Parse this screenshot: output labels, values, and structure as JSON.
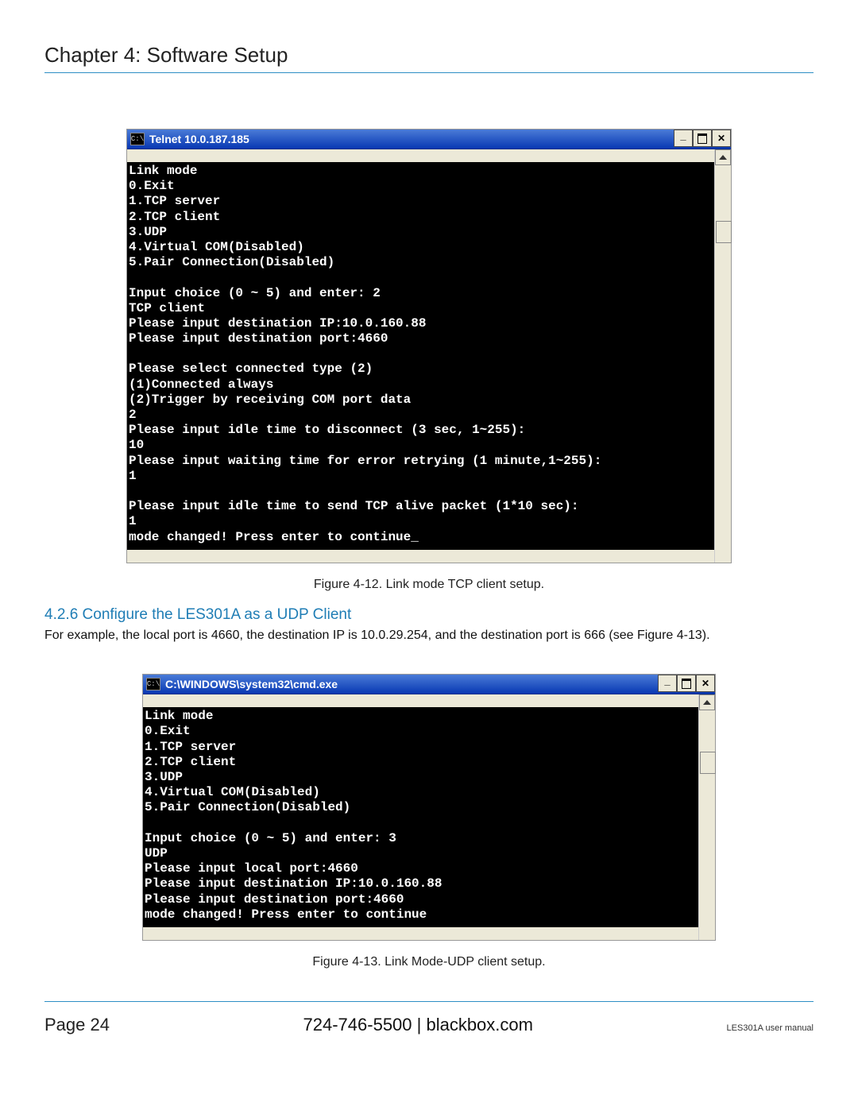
{
  "header": {
    "chapter_title": "Chapter 4: Software Setup"
  },
  "figure_12": {
    "window_title": "Telnet 10.0.187.185",
    "icon_label": "C:\\",
    "console_lines": [
      "Link mode",
      "0.Exit",
      "1.TCP server",
      "2.TCP client",
      "3.UDP",
      "4.Virtual COM(Disabled)",
      "5.Pair Connection(Disabled)",
      "",
      "Input choice (0 ~ 5) and enter: 2",
      "TCP client",
      "Please input destination IP:10.0.160.88",
      "Please input destination port:4660",
      "",
      "Please select connected type (2)",
      "(1)Connected always",
      "(2)Trigger by receiving COM port data",
      "2",
      "Please input idle time to disconnect (3 sec, 1~255):",
      "10",
      "Please input waiting time for error retrying (1 minute,1~255):",
      "1",
      "",
      "Please input idle time to send TCP alive packet (1*10 sec):",
      "1",
      "mode changed! Press enter to continue_"
    ],
    "caption": "Figure 4-12. Link mode TCP client setup."
  },
  "section_426": {
    "heading": "4.2.6 Configure the LES301A as a UDP Client",
    "paragraph": "For example, the local port is 4660, the destination IP is 10.0.29.254, and the destination port is 666 (see Figure 4-13)."
  },
  "figure_13": {
    "window_title": "C:\\WINDOWS\\system32\\cmd.exe",
    "icon_label": "C:\\",
    "console_lines": [
      "Link mode",
      "0.Exit",
      "1.TCP server",
      "2.TCP client",
      "3.UDP",
      "4.Virtual COM(Disabled)",
      "5.Pair Connection(Disabled)",
      "",
      "Input choice (0 ~ 5) and enter: 3",
      "UDP",
      "Please input local port:4660",
      "Please input destination IP:10.0.160.88",
      "Please input destination port:4660",
      "mode changed! Press enter to continue"
    ],
    "caption": "Figure 4-13.  Link Mode-UDP client setup."
  },
  "footer": {
    "page_label": "Page 24",
    "center": "724-746-5500   |   blackbox.com",
    "right": "LES301A user manual"
  }
}
